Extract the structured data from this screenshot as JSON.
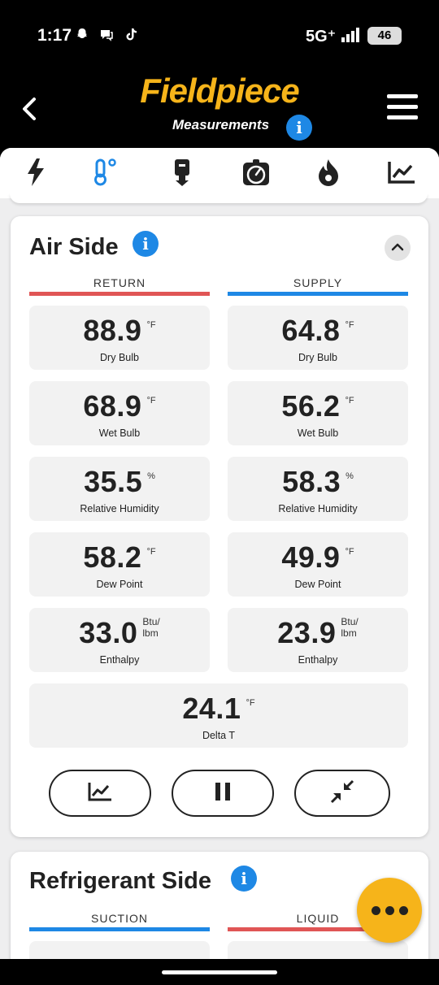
{
  "status_bar": {
    "time": "1:17",
    "network": "5G⁺",
    "battery": "46"
  },
  "header": {
    "brand": "Fieldpiece",
    "subtitle": "Measurements",
    "info_glyph": "i"
  },
  "tabs": [
    {
      "icon": "lightning-icon",
      "active": false
    },
    {
      "icon": "thermometer-icon",
      "active": true
    },
    {
      "icon": "probe-icon",
      "active": false
    },
    {
      "icon": "gauge-icon",
      "active": false
    },
    {
      "icon": "flame-icon",
      "active": false
    },
    {
      "icon": "chart-icon",
      "active": false
    }
  ],
  "air_side": {
    "title": "Air Side",
    "return_label": "RETURN",
    "supply_label": "SUPPLY",
    "return_color": "#e05555",
    "supply_color": "#1e88e5",
    "return": [
      {
        "value": "88.9",
        "unit": "°F",
        "label": "Dry Bulb"
      },
      {
        "value": "68.9",
        "unit": "°F",
        "label": "Wet Bulb"
      },
      {
        "value": "35.5",
        "unit": "%",
        "label": "Relative Humidity"
      },
      {
        "value": "58.2",
        "unit": "°F",
        "label": "Dew Point"
      },
      {
        "value": "33.0",
        "unit": "Btu/\nlbm",
        "label": "Enthalpy"
      }
    ],
    "supply": [
      {
        "value": "64.8",
        "unit": "°F",
        "label": "Dry Bulb"
      },
      {
        "value": "56.2",
        "unit": "°F",
        "label": "Wet Bulb"
      },
      {
        "value": "58.3",
        "unit": "%",
        "label": "Relative Humidity"
      },
      {
        "value": "49.9",
        "unit": "°F",
        "label": "Dew Point"
      },
      {
        "value": "23.9",
        "unit": "Btu/\nlbm",
        "label": "Enthalpy"
      }
    ],
    "delta": {
      "value": "24.1",
      "unit": "°F",
      "label": "Delta T"
    }
  },
  "refrigerant_side": {
    "title": "Refrigerant Side",
    "suction_label": "SUCTION",
    "liquid_label": "LIQUID"
  }
}
